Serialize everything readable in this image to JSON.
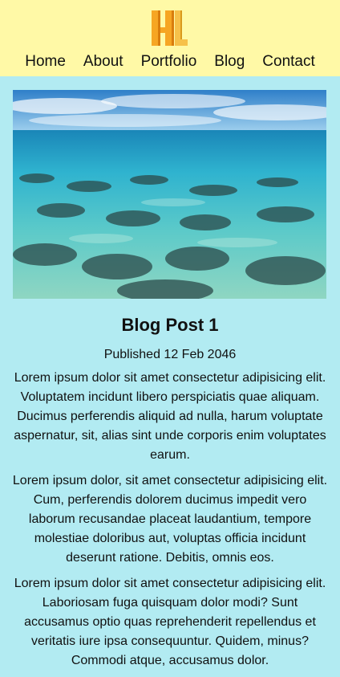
{
  "nav": {
    "items": [
      "Home",
      "About",
      "Portfolio",
      "Blog",
      "Contact"
    ]
  },
  "hero": {
    "icon": "ocean-reef-photo"
  },
  "post": {
    "title": "Blog Post 1",
    "published": "Published 12 Feb 2046",
    "paragraphs": [
      "Lorem ipsum dolor sit amet consectetur adipisicing elit. Voluptatem incidunt libero perspiciatis quae aliquam. Ducimus perferendis aliquid ad nulla, harum voluptate aspernatur, sit, alias sint unde corporis enim voluptates earum.",
      "Lorem ipsum dolor, sit amet consectetur adipisicing elit. Cum, perferendis dolorem ducimus impedit vero laborum recusandae placeat laudantium, tempore molestiae doloribus aut, voluptas officia incidunt deserunt ratione. Debitis, omnis eos.",
      "Lorem ipsum dolor sit amet consectetur adipisicing elit. Laboriosam fuga quisquam dolor modi? Sunt accusamus optio quas reprehenderit repellendus et veritatis iure ipsa consequuntur. Quidem, minus? Commodi atque, accusamus dolor."
    ]
  },
  "colors": {
    "header_bg": "#fff9a6",
    "page_bg": "#b2ebf2",
    "logo_orange": "#f6a623"
  }
}
